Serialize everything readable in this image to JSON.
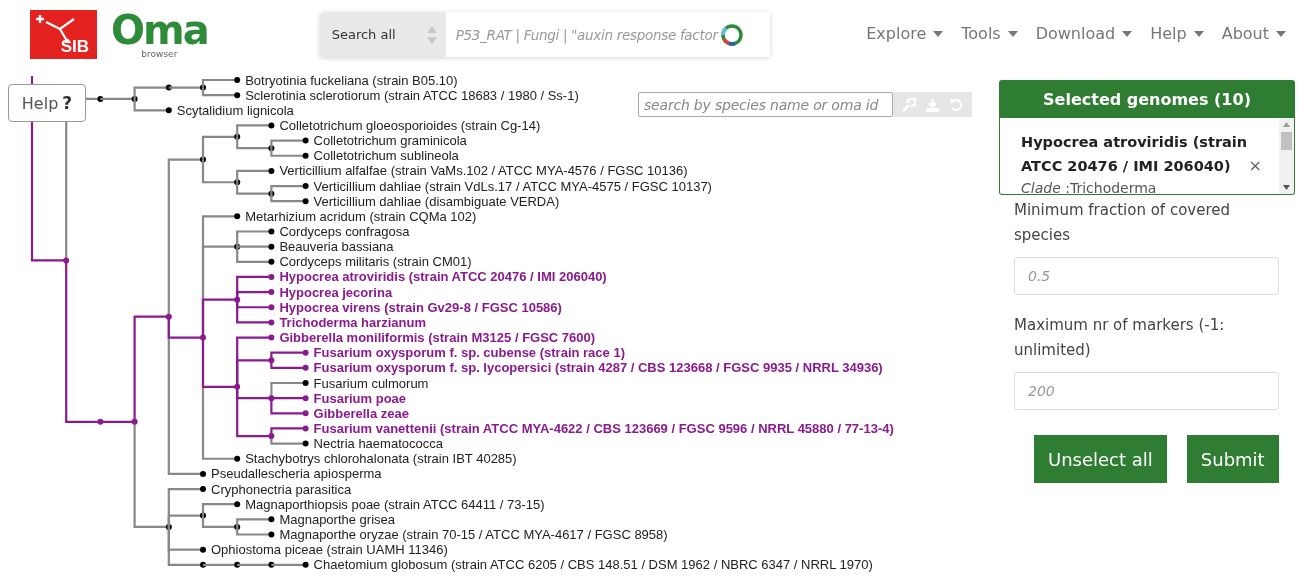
{
  "logos": {
    "sib": "SIB",
    "oma": "Oma",
    "oma_sub": "browser"
  },
  "search": {
    "scope": "Search all",
    "placeholder": "P53_RAT | Fungi | \"auxin response factor"
  },
  "nav": [
    {
      "label": "Explore"
    },
    {
      "label": "Tools"
    },
    {
      "label": "Download"
    },
    {
      "label": "Help"
    },
    {
      "label": "About"
    }
  ],
  "help_button": {
    "label": "Help",
    "icon": "?"
  },
  "species_search": {
    "placeholder": "search by species name or oma id"
  },
  "tree": {
    "children": [
      {
        "children": [
          {
            "children": [
              {
                "children": [
                  {
                    "children": [
                      {
                        "name": "Botryotinia fuckeliana (strain B05.10)",
                        "selected": false
                      },
                      {
                        "name": "Sclerotinia sclerotiorum (strain ATCC 18683 / 1980 / Ss-1)",
                        "selected": false
                      }
                    ]
                  }
                ]
              },
              {
                "name": "Scytalidium lignicola",
                "selected": false
              }
            ]
          }
        ]
      },
      {
        "children": [
          {
            "children": [
              {
                "children": [
                  {
                    "children": [
                      {
                        "children": [
                          {
                            "name": "Colletotrichum gloeosporioides (strain Cg-14)",
                            "selected": false
                          },
                          {
                            "children": [
                              {
                                "name": "Colletotrichum graminicola",
                                "selected": false
                              },
                              {
                                "name": "Colletotrichum sublineola",
                                "selected": false
                              }
                            ]
                          }
                        ]
                      },
                      {
                        "children": [
                          {
                            "name": "Verticillium alfalfae (strain VaMs.102 / ATCC MYA-4576 / FGSC 10136)",
                            "selected": false
                          },
                          {
                            "children": [
                              {
                                "name": "Verticillium dahliae (strain VdLs.17 / ATCC MYA-4575 / FGSC 10137)",
                                "selected": false
                              },
                              {
                                "name": "Verticillium dahliae (disambiguate VERDA)",
                                "selected": false
                              }
                            ]
                          }
                        ]
                      }
                    ]
                  },
                  {
                    "children": [
                      {
                        "name": "Metarhizium acridum (strain CQMa 102)",
                        "selected": false
                      },
                      {
                        "children": [
                          {
                            "name": "Cordyceps confragosa",
                            "selected": false
                          },
                          {
                            "name": "Beauveria bassiana",
                            "selected": false
                          },
                          {
                            "name": "Cordyceps militaris (strain CM01)",
                            "selected": false
                          }
                        ]
                      },
                      {
                        "children": [
                          {
                            "name": "Hypocrea atroviridis (strain ATCC 20476 / IMI 206040)",
                            "selected": true
                          },
                          {
                            "name": "Hypocrea jecorina",
                            "selected": true
                          },
                          {
                            "name": "Hypocrea virens (strain Gv29-8 / FGSC 10586)",
                            "selected": true
                          },
                          {
                            "name": "Trichoderma harzianum",
                            "selected": true
                          }
                        ]
                      },
                      {
                        "children": [
                          {
                            "name": "Gibberella moniliformis (strain M3125 / FGSC 7600)",
                            "selected": true
                          },
                          {
                            "children": [
                              {
                                "name": "Fusarium oxysporum f. sp. cubense (strain race 1)",
                                "selected": true
                              },
                              {
                                "name": "Fusarium oxysporum f. sp. lycopersici (strain 4287 / CBS 123668 / FGSC 9935 / NRRL 34936)",
                                "selected": true
                              }
                            ]
                          },
                          {
                            "children": [
                              {
                                "name": "Fusarium culmorum",
                                "selected": false
                              },
                              {
                                "name": "Fusarium poae",
                                "selected": true
                              },
                              {
                                "name": "Gibberella zeae",
                                "selected": true
                              }
                            ]
                          },
                          {
                            "children": [
                              {
                                "name": "Fusarium vanettenii (strain ATCC MYA-4622 / CBS 123669 / FGSC 9596 / NRRL 45880 / 77-13-4)",
                                "selected": true
                              },
                              {
                                "name": "Nectria haematococca",
                                "selected": false
                              }
                            ]
                          }
                        ]
                      },
                      {
                        "name": "Stachybotrys chlorohalonata (strain IBT 40285)",
                        "selected": false
                      }
                    ]
                  },
                  {
                    "name": "Pseudallescheria apiosperma",
                    "selected": false
                  }
                ]
              },
              {
                "children": [
                  {
                    "name": "Cryphonectria parasitica",
                    "selected": false
                  },
                  {
                    "children": [
                      {
                        "name": "Magnaporthiopsis poae (strain ATCC 64411 / 73-15)",
                        "selected": false
                      },
                      {
                        "children": [
                          {
                            "name": "Magnaporthe grisea",
                            "selected": false
                          },
                          {
                            "name": "Magnaporthe oryzae (strain 70-15 / ATCC MYA-4617 / FGSC 8958)",
                            "selected": false
                          }
                        ]
                      }
                    ]
                  },
                  {
                    "name": "Ophiostoma piceae (strain UAMH 11346)",
                    "selected": false
                  },
                  {
                    "children": [
                      {
                        "children": [
                          {
                            "children": [
                              {
                                "name": "Chaetomium globosum (strain ATCC 6205 / CBS 148.51 / DSM 1962 / NBRC 6347 / NRRL 1970)",
                                "selected": false
                              }
                            ]
                          }
                        ]
                      }
                    ]
                  }
                ]
              }
            ]
          }
        ]
      }
    ]
  },
  "panel": {
    "title": "Selected genomes (10)",
    "genomes": [
      {
        "name": "Hypocrea atroviridis (strain ATCC 20476 / IMI 206040)",
        "remove": "×",
        "clade": "*Clade* :Trichoderma"
      }
    ],
    "fields": [
      {
        "label": "Minimum fraction of covered species",
        "placeholder": "0.5"
      },
      {
        "label": "Maximum nr of markers (-1: unlimited)",
        "placeholder": "200"
      }
    ],
    "buttons": [
      "Unselect all",
      "Submit"
    ]
  }
}
